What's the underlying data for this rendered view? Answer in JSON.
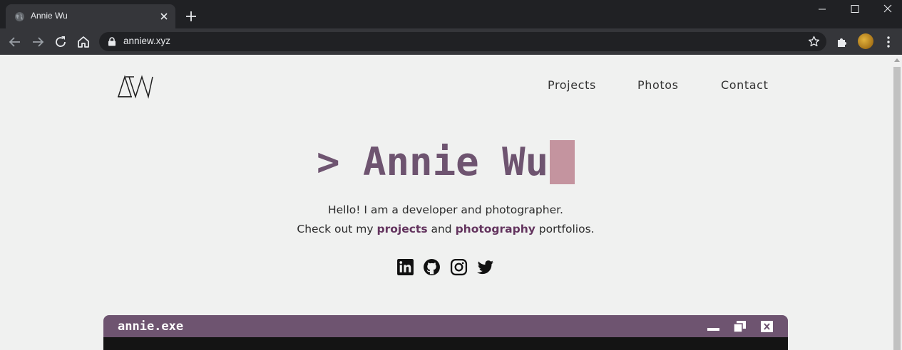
{
  "browser": {
    "tab": {
      "title": "Annie Wu",
      "favicon": "globe-icon"
    },
    "address_bar": {
      "url": "anniew.xyz",
      "secure_icon": "lock-icon"
    },
    "colors": {
      "frame": "#202124",
      "toolbar": "#35363a",
      "text": "#e8eaed"
    }
  },
  "site": {
    "logo_text": "AW",
    "nav": [
      {
        "label": "Projects"
      },
      {
        "label": "Photos"
      },
      {
        "label": "Contact"
      }
    ],
    "hero": {
      "prompt": ">",
      "name": "Annie Wu"
    },
    "intro": {
      "line1": "Hello! I am a developer and photographer.",
      "line2_prefix": "Check out my ",
      "projects_link": "projects",
      "line2_middle": " and ",
      "photography_link": "photography",
      "line2_suffix": " portfolios."
    },
    "social_icons": [
      "linkedin-icon",
      "github-icon",
      "instagram-icon",
      "twitter-icon"
    ],
    "window": {
      "title": "annie.exe"
    },
    "colors": {
      "background": "#f0f1f0",
      "accent": "#6e5470",
      "cursor": "#c4949f",
      "link": "#63345e"
    }
  }
}
